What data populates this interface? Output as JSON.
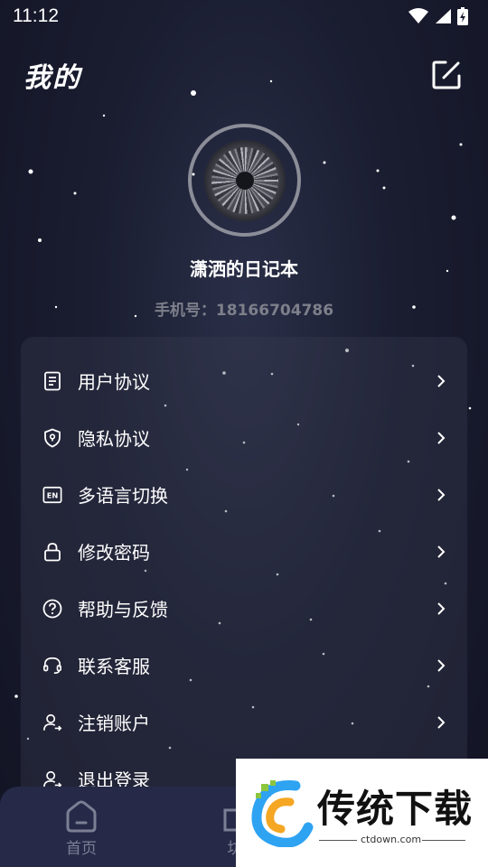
{
  "status_bar": {
    "time": "11:12"
  },
  "header": {
    "title": "我的",
    "edit_icon": "edit-square-icon"
  },
  "profile": {
    "username": "潇洒的日记本",
    "phone": "手机号：18166704786"
  },
  "menu": {
    "items": [
      {
        "label": "用户协议",
        "icon": "document-icon"
      },
      {
        "label": "隐私协议",
        "icon": "shield-lock-icon"
      },
      {
        "label": "多语言切换",
        "icon": "language-en-icon"
      },
      {
        "label": "修改密码",
        "icon": "lock-icon"
      },
      {
        "label": "帮助与反馈",
        "icon": "help-circle-icon"
      },
      {
        "label": "联系客服",
        "icon": "headset-icon"
      },
      {
        "label": "注销账户",
        "icon": "user-logout-icon"
      },
      {
        "label": "退出登录",
        "icon": "user-exit-icon"
      }
    ]
  },
  "bottom_nav": {
    "items": [
      {
        "label": "首页",
        "icon": "home-icon"
      },
      {
        "label": "坊",
        "icon": "square-icon"
      }
    ]
  },
  "watermark": {
    "title": "传统下载",
    "url": "ctdown.com"
  },
  "colors": {
    "background": "#1a1d30",
    "nav_background": "#262a48",
    "muted_text": "#7d7f8a"
  }
}
